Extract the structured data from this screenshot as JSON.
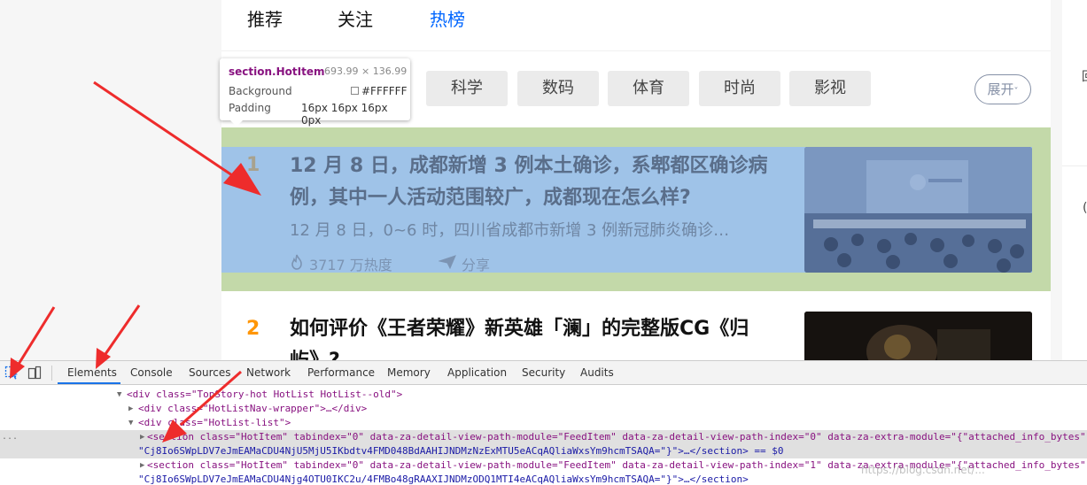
{
  "tabs": [
    {
      "label": "推荐"
    },
    {
      "label": "关注"
    },
    {
      "label": "热榜"
    }
  ],
  "categories": [
    "科学",
    "数码",
    "体育",
    "时尚",
    "影视"
  ],
  "expand_label": "展开",
  "tooltip": {
    "tag": "section.HotItem",
    "dimensions": "693.99 × 136.99",
    "background_label": "Background",
    "background_value": "#FFFFFF",
    "padding_label": "Padding",
    "padding_value": "16px 16px 16px 0px"
  },
  "hot_items": [
    {
      "rank": "1",
      "title": "12 月 8 日，成都新增 3 例本土确诊，系郫都区确诊病例，其中一人活动范围较广，成都现在怎么样?",
      "excerpt": "12 月 8 日，0~6 时，四川省成都市新增 3 例新冠肺炎确诊…",
      "heat": "3717 万热度",
      "share": "分享"
    },
    {
      "rank": "2",
      "title": "如何评价《王者荣耀》新英雄「澜」的完整版CG《归屿》?"
    }
  ],
  "right_glyphs": [
    "回",
    "("
  ],
  "devtools": {
    "tabs": [
      "Elements",
      "Console",
      "Sources",
      "Network",
      "Performance",
      "Memory",
      "Application",
      "Security",
      "Audits"
    ],
    "active_tab": "Elements",
    "lines": [
      {
        "open": "▼",
        "text": "<div class=\"TopStory-hot HotList HotList--old\">"
      },
      {
        "open": "▶",
        "text": "<div class=\"HotListNav-wrapper\">…</div>"
      },
      {
        "open": "▼",
        "text": "<div class=\"HotList-list\">"
      },
      {
        "open": "▶",
        "text": "<section class=\"HotItem\" tabindex=\"0\" data-za-detail-view-path-module=\"FeedItem\" data-za-detail-view-path-index=\"0\" data-za-extra-module=\"{\"attached_info_bytes\":",
        "cont": "\"Cj8Io6SWpLDV7eJmEAMaCDU4NjU5MjU5IKbdtv4FMD048BdAAHIJNDMzNzExMTU5eACqAQliaWxsYm9hcmTSAQA=\"}\">…</section> == $0"
      },
      {
        "open": "▶",
        "text": "<section class=\"HotItem\" tabindex=\"0\" data-za-detail-view-path-module=\"FeedItem\" data-za-detail-view-path-index=\"1\" data-za-extra-module=\"{\"attached_info_bytes\":",
        "cont": "\"Cj8Io6SWpLDV7eJmEAMaCDU4Njg4OTU0IKC2u/4FMBo48gRAAXIJNDMzODQ1MTI4eACqAQliaWxsYm9hcmTSAQA=\"}\">…</section>"
      }
    ],
    "selected_marker": "...",
    "watermark": "https://blog.csdn.net/..."
  },
  "colors": {
    "accent": "#0066ff",
    "highlight_content": "#9fc3e8",
    "highlight_padding": "#c3d9a9",
    "annotation_red": "#ee2c2c"
  }
}
